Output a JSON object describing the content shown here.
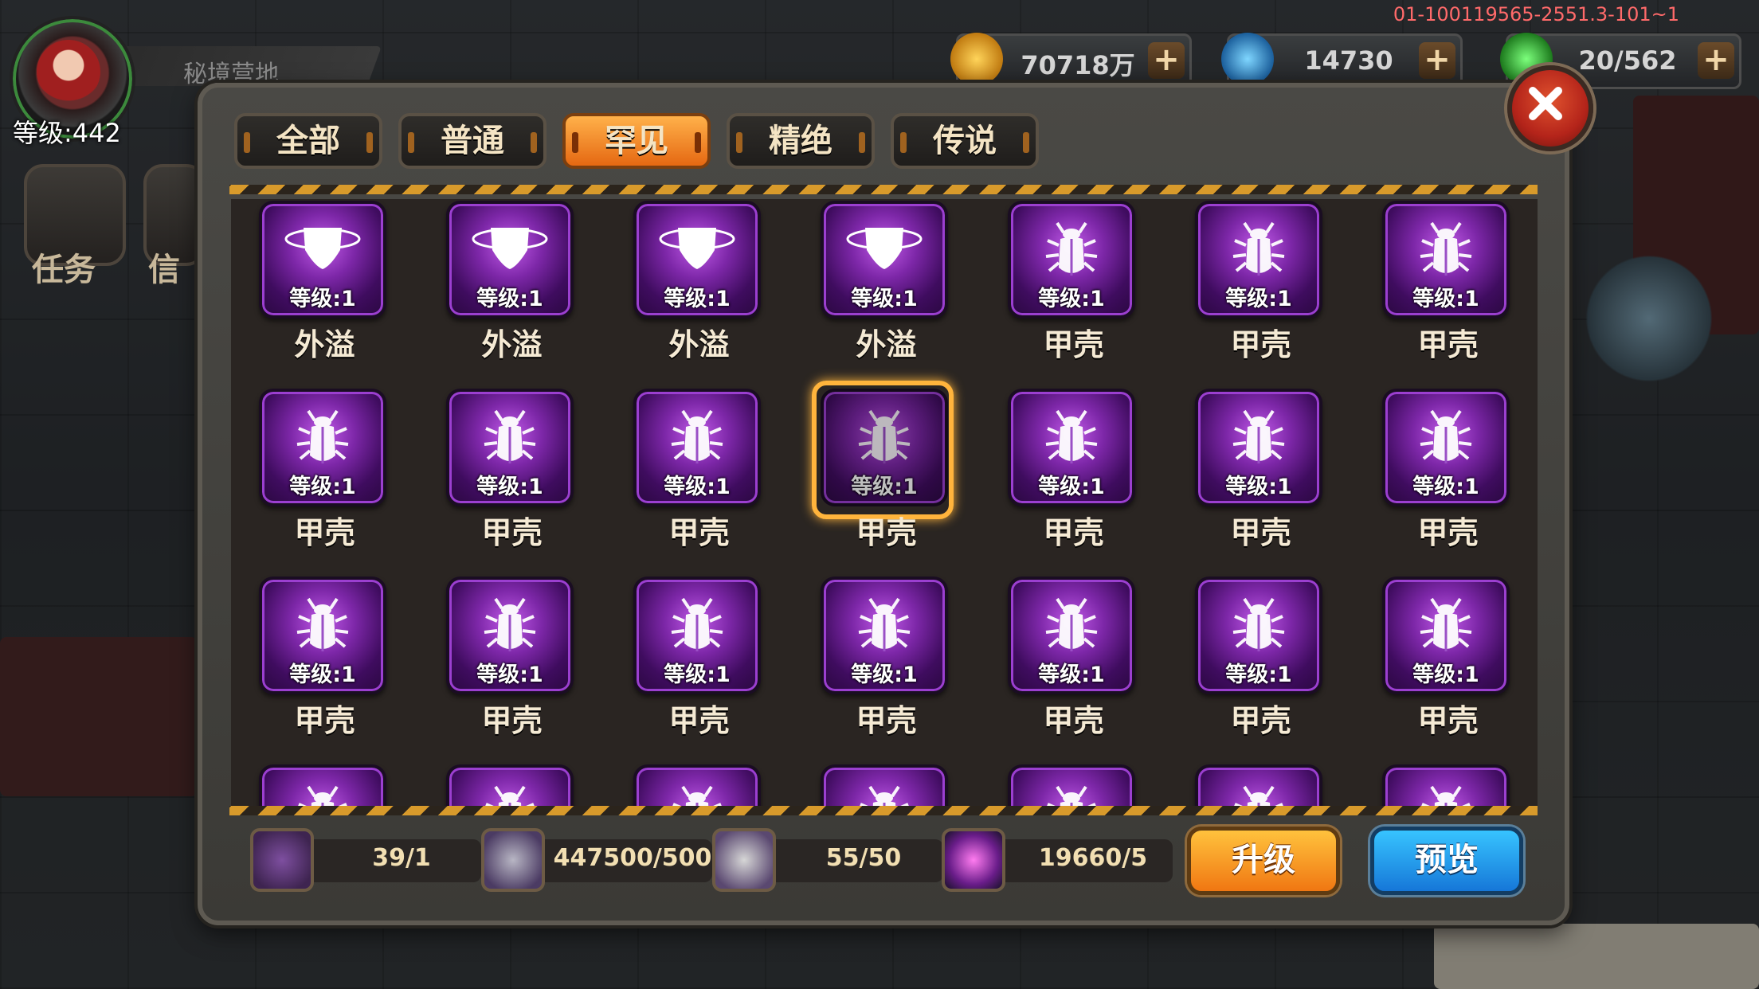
{
  "build_id": "01-100119565-2551.3-101~1",
  "player": {
    "name": "秘境营地",
    "level_label": "等级:442"
  },
  "side_buttons": [
    {
      "label": "任务"
    },
    {
      "label": "信"
    }
  ],
  "resources": [
    {
      "icon": "gold-coin-icon",
      "value": "70718万",
      "plus": "+"
    },
    {
      "icon": "blue-gem-icon",
      "value": "14730",
      "plus": "+"
    },
    {
      "icon": "green-energy-icon",
      "value": "20/562",
      "plus": "+"
    }
  ],
  "tabs": [
    {
      "label": "全部",
      "active": false
    },
    {
      "label": "普通",
      "active": false
    },
    {
      "label": "罕见",
      "active": true
    },
    {
      "label": "精绝",
      "active": false
    },
    {
      "label": "传说",
      "active": false
    }
  ],
  "items": [
    {
      "name": "外溢",
      "level": "等级:1",
      "icon": "shield-ring-icon"
    },
    {
      "name": "外溢",
      "level": "等级:1",
      "icon": "shield-ring-icon"
    },
    {
      "name": "外溢",
      "level": "等级:1",
      "icon": "shield-ring-icon"
    },
    {
      "name": "外溢",
      "level": "等级:1",
      "icon": "shield-ring-icon"
    },
    {
      "name": "甲壳",
      "level": "等级:1",
      "icon": "beetle-icon"
    },
    {
      "name": "甲壳",
      "level": "等级:1",
      "icon": "beetle-icon"
    },
    {
      "name": "甲壳",
      "level": "等级:1",
      "icon": "beetle-icon"
    },
    {
      "name": "甲壳",
      "level": "等级:1",
      "icon": "beetle-icon"
    },
    {
      "name": "甲壳",
      "level": "等级:1",
      "icon": "beetle-icon"
    },
    {
      "name": "甲壳",
      "level": "等级:1",
      "icon": "beetle-icon"
    },
    {
      "name": "甲壳",
      "level": "等级:1",
      "icon": "beetle-icon",
      "selected": true
    },
    {
      "name": "甲壳",
      "level": "等级:1",
      "icon": "beetle-icon"
    },
    {
      "name": "甲壳",
      "level": "等级:1",
      "icon": "beetle-icon"
    },
    {
      "name": "甲壳",
      "level": "等级:1",
      "icon": "beetle-icon"
    },
    {
      "name": "甲壳",
      "level": "等级:1",
      "icon": "beetle-icon"
    },
    {
      "name": "甲壳",
      "level": "等级:1",
      "icon": "beetle-icon"
    },
    {
      "name": "甲壳",
      "level": "等级:1",
      "icon": "beetle-icon"
    },
    {
      "name": "甲壳",
      "level": "等级:1",
      "icon": "beetle-icon"
    },
    {
      "name": "甲壳",
      "level": "等级:1",
      "icon": "beetle-icon"
    },
    {
      "name": "甲壳",
      "level": "等级:1",
      "icon": "beetle-icon"
    },
    {
      "name": "甲壳",
      "level": "等级:1",
      "icon": "beetle-icon"
    },
    {
      "name": "",
      "level": "",
      "icon": "beetle-icon"
    },
    {
      "name": "",
      "level": "",
      "icon": "beetle-icon"
    },
    {
      "name": "",
      "level": "",
      "icon": "beetle-icon"
    },
    {
      "name": "",
      "level": "",
      "icon": "beetle-icon"
    },
    {
      "name": "",
      "level": "",
      "icon": "beetle-icon"
    },
    {
      "name": "",
      "level": "",
      "icon": "beetle-icon"
    },
    {
      "name": "",
      "level": "",
      "icon": "beetle-icon"
    }
  ],
  "materials": [
    {
      "icon": "beetle-card-icon",
      "value": "39/1"
    },
    {
      "icon": "circuit-chip-icon",
      "value": "447500/500"
    },
    {
      "icon": "metal-plate-icon",
      "value": "55/50"
    },
    {
      "icon": "purple-orb-icon",
      "value": "19660/5"
    }
  ],
  "buttons": {
    "upgrade": "升级",
    "preview": "预览"
  },
  "colors": {
    "rare_purple": "#7d27a8",
    "selected_orange": "#ffb43c",
    "upgrade_orange": "#f07712",
    "preview_blue": "#1677d8"
  }
}
